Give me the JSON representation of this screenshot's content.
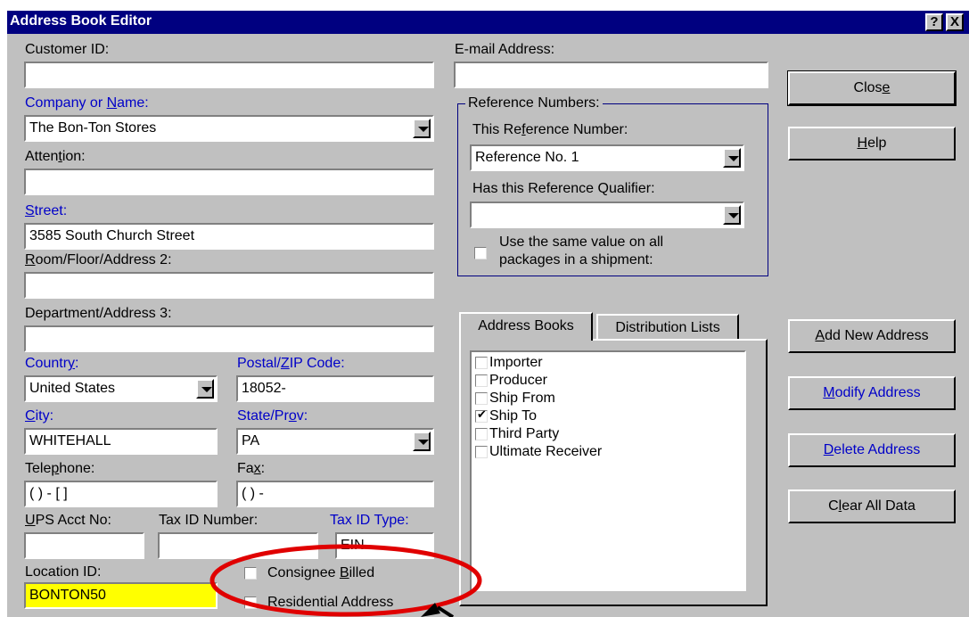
{
  "window": {
    "title": "Address Book Editor",
    "help_glyph": "?",
    "close_glyph": "X"
  },
  "left": {
    "customer_id": {
      "label": "Customer ID:",
      "value": ""
    },
    "company": {
      "label": "Company or Name:",
      "value": "The Bon-Ton Stores"
    },
    "attention": {
      "label": "Attention:",
      "value": ""
    },
    "street": {
      "label": "Street:",
      "value": "3585 South Church Street"
    },
    "room": {
      "label": "Room/Floor/Address 2:",
      "value": ""
    },
    "department": {
      "label": "Department/Address 3:",
      "value": ""
    },
    "country": {
      "label": "Country:",
      "value": "United States"
    },
    "postal": {
      "label": "Postal/ZIP Code:",
      "value": "18052-"
    },
    "city": {
      "label": "City:",
      "value": "WHITEHALL"
    },
    "state": {
      "label": "State/Prov:",
      "value": "PA"
    },
    "telephone": {
      "label": "Telephone:",
      "value": "(   )    -      [     ]"
    },
    "fax": {
      "label": "Fax:",
      "value": "(   )    -"
    },
    "ups_acct": {
      "label": "UPS Acct No:",
      "value": ""
    },
    "tax_id": {
      "label": "Tax ID Number:",
      "value": ""
    },
    "tax_type": {
      "label": "Tax ID Type:",
      "value": "EIN"
    },
    "location": {
      "label": "Location ID:",
      "value": "BONTON50"
    },
    "consignee": {
      "label": "Consignee Billed",
      "checked": false
    },
    "residential": {
      "label": "Residential Address",
      "checked": false
    }
  },
  "email": {
    "label": "E-mail Address:",
    "value": ""
  },
  "reference": {
    "legend": "Reference Numbers:",
    "this_label": "This Reference Number:",
    "this_value": "Reference No. 1",
    "qualifier_label": "Has this Reference Qualifier:",
    "qualifier_value": "",
    "same_value_line1": "Use the same value on all",
    "same_value_line2": "packages in a shipment:",
    "same_value_checked": false
  },
  "tabs": [
    "Address Books",
    "Distribution Lists"
  ],
  "books": [
    {
      "label": "Importer",
      "checked": false
    },
    {
      "label": "Producer",
      "checked": false
    },
    {
      "label": "Ship From",
      "checked": false
    },
    {
      "label": "Ship To",
      "checked": true
    },
    {
      "label": "Third Party",
      "checked": false
    },
    {
      "label": "Ultimate Receiver",
      "checked": false
    }
  ],
  "buttons": {
    "close": "Close",
    "help": "Help",
    "add": "Add New Address",
    "modify": "Modify Address",
    "delete": "Delete Address",
    "clear": "Clear All Data"
  },
  "colors": {
    "highlight_oval": "#e00000",
    "title_bar": "#000080",
    "label_blue": "#0000c8",
    "location_field": "#ffff00"
  }
}
